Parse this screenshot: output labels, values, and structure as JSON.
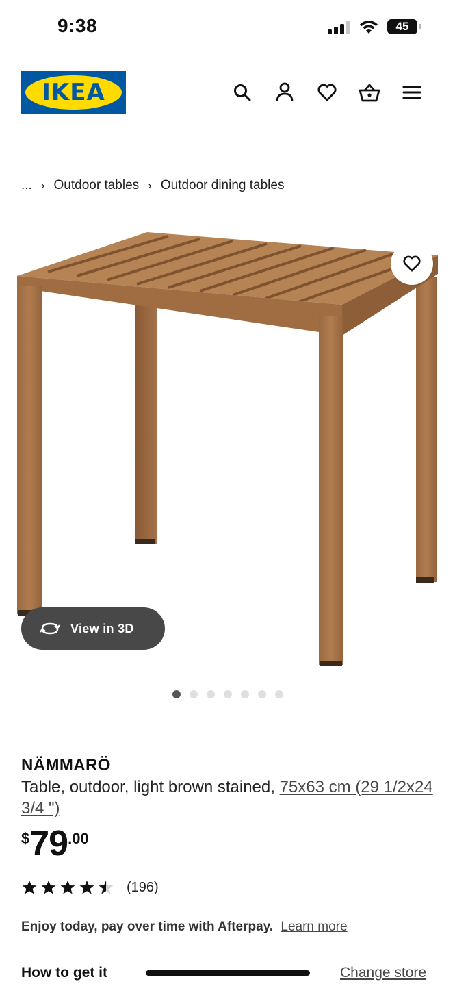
{
  "status_bar": {
    "time": "9:38",
    "battery": "45"
  },
  "header": {
    "logo_text": "IKEA",
    "icons": [
      "search-icon",
      "user-icon",
      "heart-icon",
      "basket-icon",
      "menu-icon"
    ],
    "colors": {
      "brand_blue": "#0058a3",
      "brand_yellow": "#ffdb00"
    }
  },
  "breadcrumb": {
    "ellipsis": "...",
    "items": [
      "Outdoor tables",
      "Outdoor dining tables"
    ]
  },
  "gallery": {
    "view_3d_label": "View in 3D",
    "image_count": 7,
    "active_index": 0
  },
  "product": {
    "name": "NÄMMARÖ",
    "description": "Table, outdoor, light brown stained,",
    "size_link": "75x63 cm (29 1/2x24 3/4 \")",
    "price": {
      "currency": "$",
      "main": "79",
      "cents": ".00"
    },
    "rating": {
      "value": 4.5,
      "max": 5,
      "count": "(196)"
    }
  },
  "afterpay": {
    "text": "Enjoy today, pay over time with Afterpay.",
    "link": "Learn more"
  },
  "delivery": {
    "title": "How to get it",
    "change_store": "Change store"
  }
}
